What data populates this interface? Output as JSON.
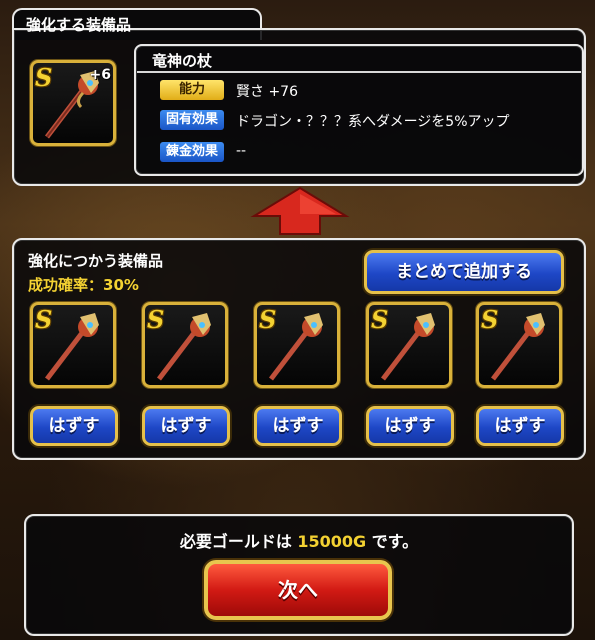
{
  "top_panel": {
    "title": "強化する装備品",
    "item": {
      "rank": "S",
      "plus": "+6",
      "icon": "dragon-staff-icon"
    },
    "detail": {
      "name": "竜神の杖",
      "rows": [
        {
          "badge": "能力",
          "badge_color": "#e9b422",
          "value": "賢さ +76"
        },
        {
          "badge": "固有効果",
          "badge_color": "#2b6fdd",
          "value": "ドラゴン・？？？系へダメージを5%アップ"
        },
        {
          "badge": "錬金効果",
          "badge_color": "#2b6fdd",
          "value": "--"
        }
      ]
    }
  },
  "material_panel": {
    "title": "強化につかう装備品",
    "success_label": "成功確率：",
    "success_value": "30%",
    "bulk_button": "まとめて追加する",
    "slots": [
      {
        "rank": "S",
        "icon": "dragon-staff-icon",
        "remove_label": "はずす"
      },
      {
        "rank": "S",
        "icon": "dragon-staff-icon",
        "remove_label": "はずす"
      },
      {
        "rank": "S",
        "icon": "dragon-staff-icon",
        "remove_label": "はずす"
      },
      {
        "rank": "S",
        "icon": "dragon-staff-icon",
        "remove_label": "はずす"
      },
      {
        "rank": "S",
        "icon": "dragon-staff-icon",
        "remove_label": "はずす"
      }
    ]
  },
  "footer": {
    "gold_prefix": "必要ゴールドは ",
    "gold_amount": "15000G",
    "gold_suffix": " です。",
    "next_button": "次へ"
  },
  "colors": {
    "gold_text": "#f4d232",
    "accent_border": "#e5c04a",
    "arrow_red": "#d8281e"
  }
}
